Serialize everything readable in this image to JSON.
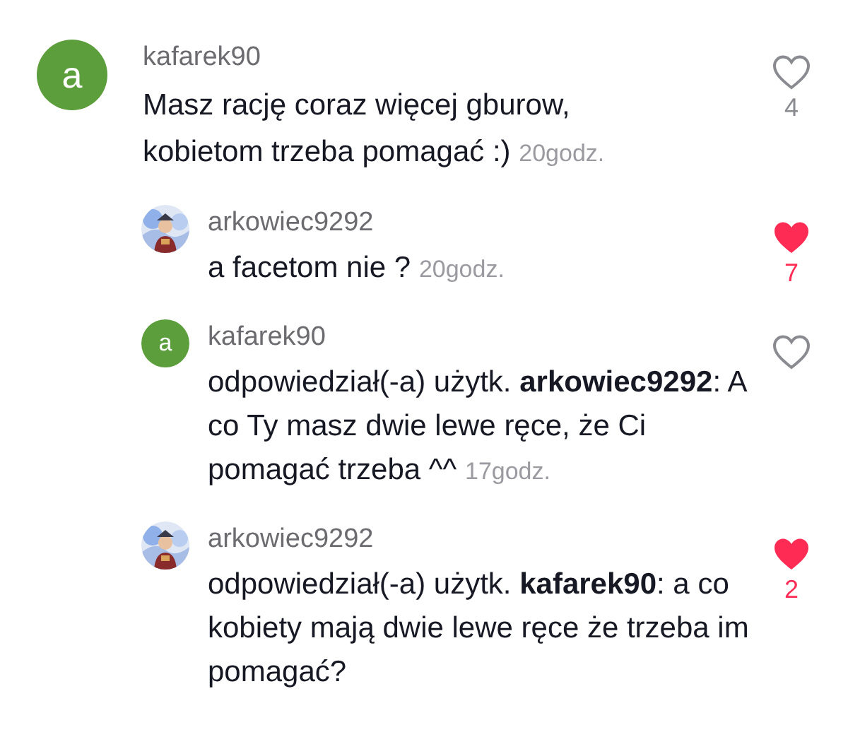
{
  "comments": [
    {
      "username": "kafarek90",
      "avatar": {
        "kind": "letter",
        "letter": "a",
        "color": "#5c9e3c"
      },
      "text": "Masz rację coraz więcej gburow, kobietom trzeba pomagać :)",
      "time": "20godz.",
      "liked": false,
      "likes": "4",
      "replies": [
        {
          "username": "arkowiec9292",
          "text": "a facetom nie ?",
          "time": "20godz.",
          "liked": true,
          "likes": "7"
        },
        {
          "username": "kafarek90",
          "avatar": {
            "kind": "letter",
            "letter": "a",
            "color": "#5c9e3c"
          },
          "text": "odpowiedział(-a) użytk. **arkowiec9292**: A co Ty masz dwie lewe ręce, że Ci pomagać trzeba ^^",
          "time": "17godz.",
          "liked": false
        },
        {
          "username": "arkowiec9292",
          "text": "odpowiedział(-a) użytk. **kafarek90**: a co kobiety mają dwie lewe ręce że trzeba im pomagać?",
          "liked": true,
          "likes": "2"
        }
      ]
    }
  ]
}
